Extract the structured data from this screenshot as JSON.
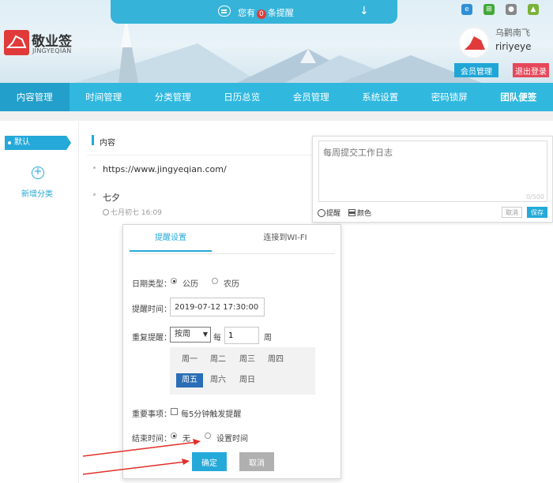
{
  "notice": {
    "prefix": "您有",
    "count": "0",
    "suffix": "条提醒"
  },
  "brand": {
    "name": "敬业签",
    "sub": "JINGYEQIAN"
  },
  "user": {
    "title": "乌鹳南飞",
    "name": "ririyeye",
    "member_btn": "会员管理",
    "logout_btn": "退出登录"
  },
  "nav": [
    "内容管理",
    "时间管理",
    "分类管理",
    "日历总览",
    "会员管理",
    "系统设置",
    "密码锁屏",
    "团队便签"
  ],
  "sidebar": {
    "default": "默认",
    "add": "新增分类"
  },
  "content": {
    "heading": "内容",
    "items": [
      {
        "text": "https://www.jingyeqian.com/"
      },
      {
        "text": "七夕",
        "date": "七月初七 16:09"
      }
    ]
  },
  "editor": {
    "placeholder": "每周提交工作日志",
    "count": "0/500",
    "remind": "提醒",
    "color": "颜色",
    "cancel": "取消",
    "save": "保存"
  },
  "popup": {
    "tabs": [
      "提醒设置",
      "连接到WI-FI"
    ],
    "date_type_label": "日期类型：",
    "date_type_options": [
      "公历",
      "农历"
    ],
    "remind_time_label": "提醒时间：",
    "remind_time_value": "2019-07-12 17:30:00",
    "repeat_label": "重复提醒：",
    "repeat_select": "按周",
    "repeat_every": "每",
    "repeat_num": "1",
    "repeat_unit": "周",
    "weekdays": [
      "周一",
      "周二",
      "周三",
      "周四",
      "周五",
      "周六",
      "周日"
    ],
    "selected_weekday": "周五",
    "important_label": "重要事项：",
    "important_option": "每5分钟触发提醒",
    "end_label": "结束时间：",
    "end_options": [
      "无",
      "设置时间"
    ],
    "ok": "确定",
    "cancel": "取消"
  },
  "colors": {
    "accent": "#30b8df",
    "nav_active": "#229fca",
    "logo": "#e13a3a",
    "logout": "#e5485a",
    "selected_day": "#2b6db6"
  }
}
